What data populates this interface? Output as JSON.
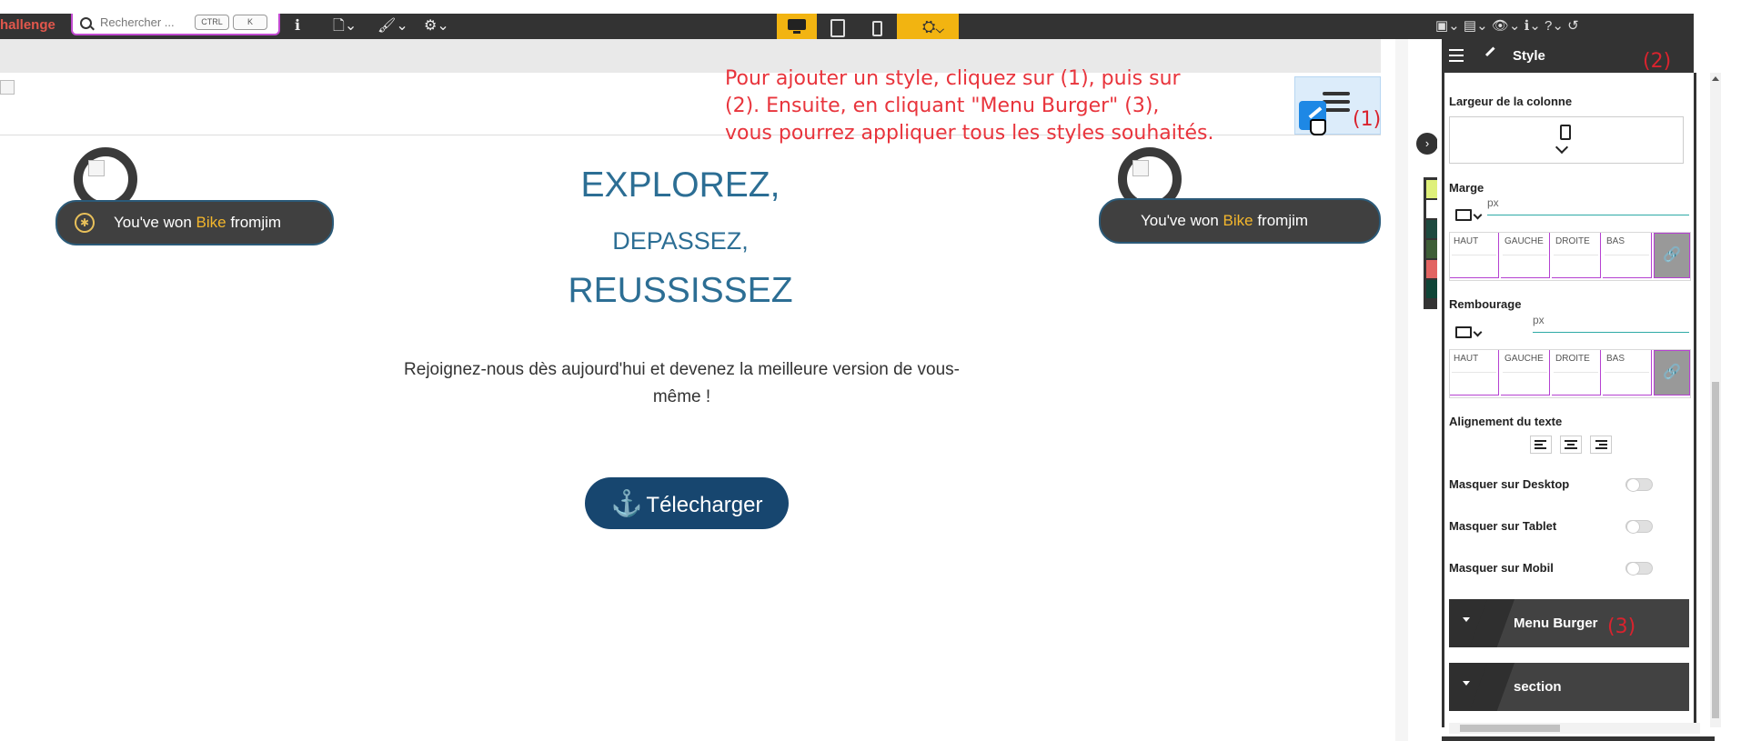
{
  "toolbar": {
    "brand": "hallenge",
    "search_placeholder": "Rechercher ...",
    "kbd_ctrl": "CTRL",
    "kbd_k": "K",
    "info_glyph": "ℹ",
    "page_glyph": "🗋⌄",
    "brush_glyph": "🖌⌄",
    "gear_glyph": "⚙⌄",
    "device_settings_glyph": "⛭⌄",
    "right_icons": "▣⌄  ▤⌄  👁⌄  ℹ⌄  ?⌄  ↺"
  },
  "instructions": {
    "line1": "Pour ajouter un style, cliquez sur (1), puis sur",
    "line2": "(2). Ensuite, en cliquant \"Menu Burger\" (3),",
    "line3": "vous pourrez appliquer tous les styles souhaités.",
    "mark1": "(1)",
    "mark2": "(2)",
    "mark3": "(3)"
  },
  "badges": {
    "left": {
      "prefix": "You've won ",
      "item": "Bike",
      "suffix": " fromjim"
    },
    "right": {
      "prefix": "You've won ",
      "item": "Bike",
      "suffix": " fromjim"
    }
  },
  "hero": {
    "line1": "EXPLOREZ,",
    "line2": "DEPASSEZ,",
    "line3": "REUSSISSEZ",
    "text": "Rejoignez-nous dès aujourd'hui et devenez la meilleure version de vous-même !",
    "button_label": "Télecharger",
    "button_icon": "⚓"
  },
  "panel": {
    "tab_style": "Style",
    "col_width_label": "Largeur de la colonne",
    "marge_label": "Marge",
    "rembourage_label": "Rembourage",
    "unit": "px",
    "sides": [
      "HAUT",
      "GAUCHE",
      "DROITE",
      "BAS"
    ],
    "link_glyph": "🔗",
    "align_label": "Alignement du texte",
    "toggles": [
      "Masquer sur Desktop",
      "Masquer sur Tablet",
      "Masquer sur Mobil"
    ],
    "accordions": [
      "Menu Burger",
      "section"
    ]
  },
  "colors": {
    "accent_red": "#e8343c",
    "hero_blue": "#2c6e94",
    "button_navy": "#17466f",
    "toolbar_bg": "#333333",
    "device_yellow": "#f2b411",
    "swatches": [
      "#dff07a",
      "#ffffff",
      "#1d4a3f",
      "#3e5e37",
      "#e26462",
      "#0f4537"
    ]
  }
}
